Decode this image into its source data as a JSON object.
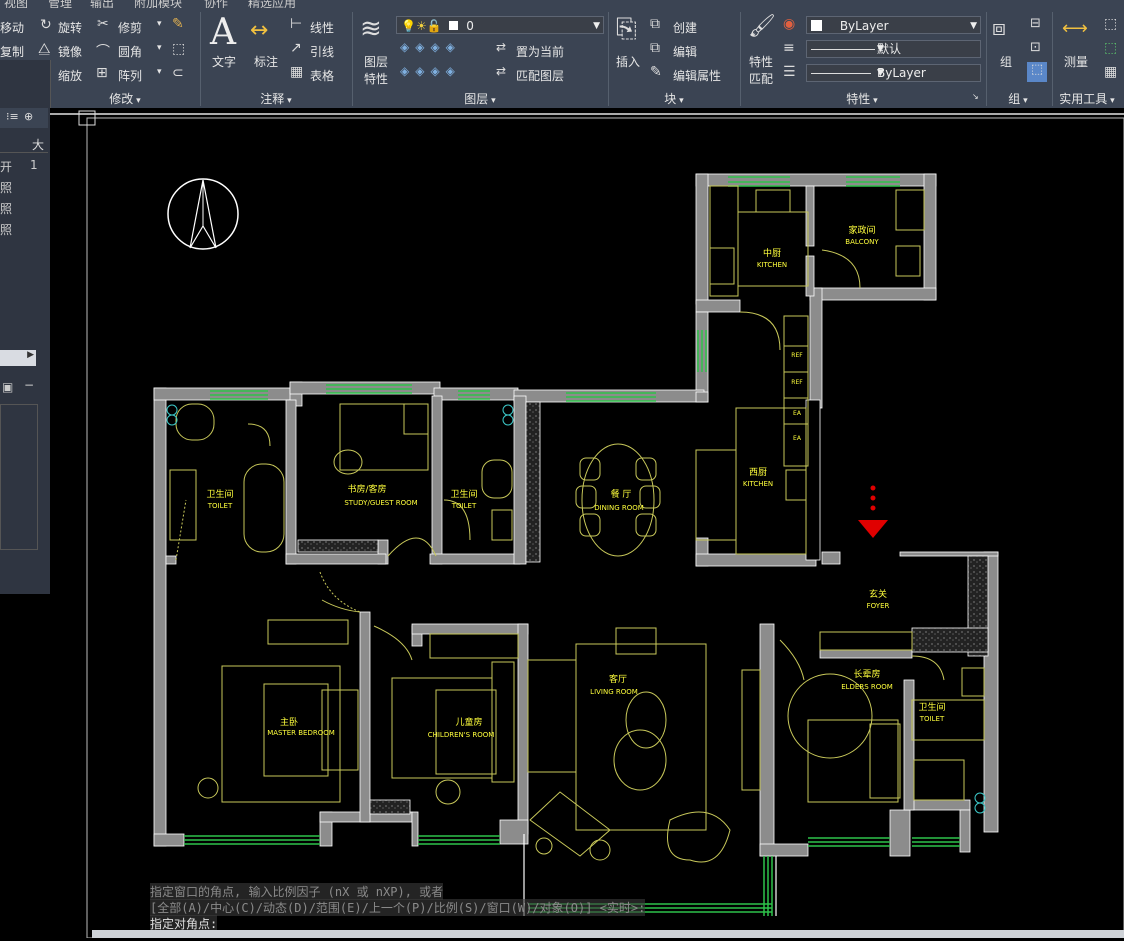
{
  "menu": {
    "items": [
      "视图",
      "管理",
      "输出",
      "附加模块",
      "协作",
      "精选应用"
    ]
  },
  "panels": {
    "modify": {
      "title": "修改",
      "move": "移动",
      "rotate": "旋转",
      "trim": "修剪",
      "copy": "复制",
      "mirror": "镜像",
      "fillet": "圆角",
      "stretch": "缩放",
      "array": "阵列"
    },
    "annotation": {
      "title": "注释",
      "text": "文字",
      "dimension": "标注",
      "linear": "线性",
      "leader": "引线",
      "table": "表格"
    },
    "layers": {
      "title": "图层",
      "layer_properties_1": "图层",
      "layer_properties_2": "特性",
      "current_layer": "0",
      "make_current": "置为当前",
      "match_layer": "匹配图层"
    },
    "block": {
      "title": "块",
      "insert": "插入",
      "create": "创建",
      "edit": "编辑",
      "edit_attributes": "编辑属性"
    },
    "properties": {
      "title": "特性",
      "match_1": "特性",
      "match_2": "匹配",
      "color": "ByLayer",
      "lineweight": "默认",
      "linetype": "ByLayer"
    },
    "groups": {
      "title": "组",
      "group": "组"
    },
    "utilities": {
      "title": "实用工具",
      "measure": "测量"
    }
  },
  "left_palette": {
    "rows": [
      "开",
      "照",
      "照",
      "照"
    ],
    "col_header": "大",
    "row_value": "1"
  },
  "rooms": {
    "kitchen_zh": "中厨",
    "kitchen_en": "KITCHEN",
    "balcony_zh": "家政间",
    "balcony_en": "BALCONY",
    "ref1": "REF",
    "ref2": "REF",
    "ea1": "EA",
    "ea2": "EA",
    "toilet1_zh": "卫生间",
    "toilet1_en": "TOILET",
    "study_zh": "书房/客房",
    "study_en": "STUDY/GUEST ROOM",
    "toilet2_zh": "卫生间",
    "toilet2_en": "TOILET",
    "dining_zh": "餐 厅",
    "dining_en": "DINING ROOM",
    "west_kitchen_zh": "西厨",
    "west_kitchen_en": "KITCHEN",
    "foyer_zh": "玄关",
    "foyer_en": "FOYER",
    "master_zh": "主卧",
    "master_en": "MASTER BEDROOM",
    "children_zh": "儿童房",
    "children_en": "CHILDREN'S ROOM",
    "living_zh": "客厅",
    "living_en": "LIVING ROOM",
    "elders_zh": "长辈房",
    "elders_en": "ELDERS ROOM",
    "toilet3_zh": "卫生间",
    "toilet3_en": "TOILET"
  },
  "command": {
    "line1": "指定窗口的角点, 输入比例因子 (nX 或 nXP), 或者",
    "line2": "[全部(A)/中心(C)/动态(D)/范围(E)/上一个(P)/比例(S)/窗口(W)/对象(O)] <实时>:",
    "line3": "指定对角点:"
  },
  "colors": {
    "wall": "#8c8c8c",
    "wall_edge": "#ffffff",
    "window": "#2ec24a",
    "furniture": "#c8c85a",
    "label": "#ffff3c",
    "marker": "#e00000",
    "ribbon": "#3b4453"
  }
}
